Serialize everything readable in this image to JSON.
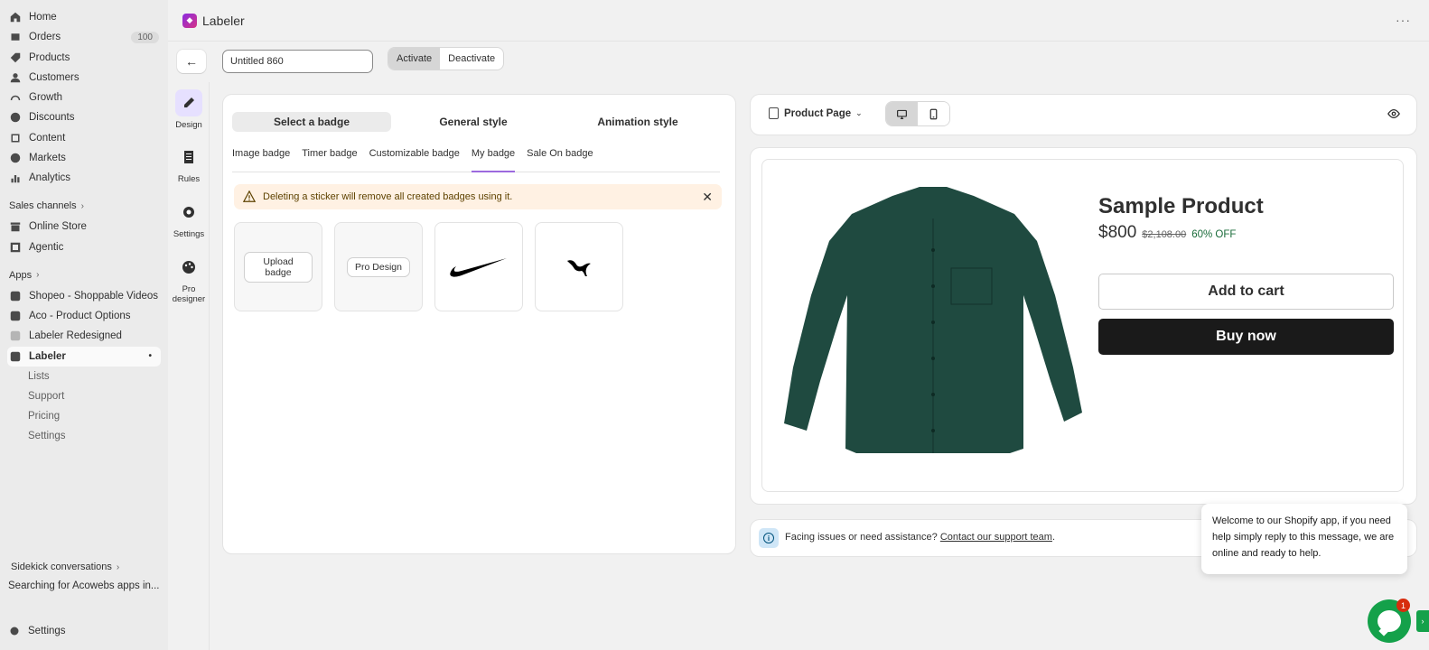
{
  "sidebar": {
    "items": [
      {
        "label": "Home",
        "icon": "home-icon"
      },
      {
        "label": "Orders",
        "icon": "orders-icon",
        "count": "100"
      },
      {
        "label": "Products",
        "icon": "tag-icon"
      },
      {
        "label": "Customers",
        "icon": "person-icon"
      },
      {
        "label": "Growth",
        "icon": "gauge-icon"
      },
      {
        "label": "Discounts",
        "icon": "discount-icon"
      },
      {
        "label": "Content",
        "icon": "content-icon"
      },
      {
        "label": "Markets",
        "icon": "globe-icon"
      },
      {
        "label": "Analytics",
        "icon": "bar-chart-icon"
      }
    ],
    "sales_channels_label": "Sales channels",
    "channels": [
      {
        "label": "Online Store",
        "icon": "store-icon"
      },
      {
        "label": "Agentic",
        "icon": "agentic-icon"
      }
    ],
    "apps_label": "Apps",
    "apps": [
      {
        "label": "Shopeo - Shoppable Videos",
        "icon": "shopeo-icon"
      },
      {
        "label": "Aco - Product Options",
        "icon": "aco-icon"
      },
      {
        "label": "Labeler Redesigned",
        "icon": "labeler-redesigned-icon"
      },
      {
        "label": "Labeler",
        "icon": "labeler-icon"
      }
    ],
    "sub_items": [
      "Lists",
      "Support",
      "Pricing",
      "Settings"
    ],
    "sidekick_label": "Sidekick conversations",
    "sidekick_item": "Searching for Acowebs apps in...",
    "settings_label": "Settings"
  },
  "header": {
    "title": "Labeler",
    "more": "···"
  },
  "toolbar": {
    "back": "←",
    "name_value": "Untitled 860",
    "activate": "Activate",
    "deactivate": "Deactivate"
  },
  "rail": [
    {
      "label": "Design",
      "icon": "pencil-icon"
    },
    {
      "label": "Rules",
      "icon": "rules-icon"
    },
    {
      "label": "Settings",
      "icon": "gear-icon"
    },
    {
      "label": "Pro designer",
      "icon": "palette-icon"
    }
  ],
  "editor": {
    "main_tabs": [
      "Select a badge",
      "General style",
      "Animation style"
    ],
    "sub_tabs": [
      "Image badge",
      "Timer badge",
      "Customizable badge",
      "My badge",
      "Sale On badge"
    ],
    "alert_text": "Deleting a sticker will remove all created badges using it.",
    "alert_close": "✕",
    "upload_badge": "Upload badge",
    "pro_design": "Pro Design"
  },
  "preview": {
    "page_select": "Product Page",
    "product_title": "Sample Product",
    "price": "$800",
    "compare_price": "$2,108.00",
    "discount": "60% OFF",
    "add_to_cart": "Add to cart",
    "buy_now": "Buy now",
    "shirt_color": "#1f4a40"
  },
  "help": {
    "text": "Facing issues or need assistance?",
    "link": "Contact our support team",
    "suffix": "."
  },
  "chat": {
    "message": "Welcome to our Shopify app, if you need help simply reply to this message, we are online and ready to help.",
    "unread": "1",
    "side_tab": "›"
  }
}
